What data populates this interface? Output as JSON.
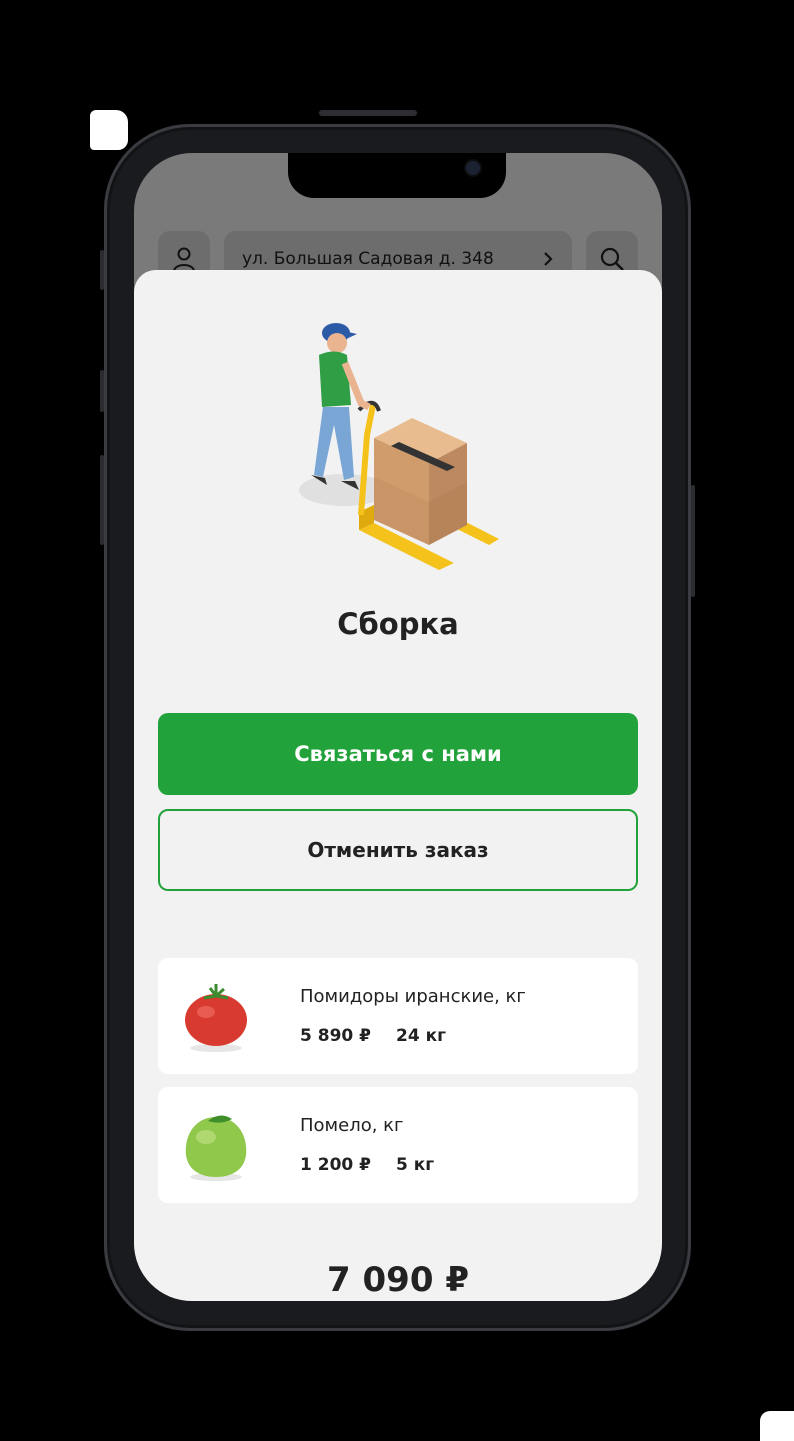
{
  "header": {
    "address": "ул. Большая Садовая д. 348",
    "icons": [
      "user-icon",
      "chevron-right-icon",
      "search-icon"
    ]
  },
  "order": {
    "status_title": "Сборка",
    "contact_label": "Связаться с нами",
    "cancel_label": "Отменить заказ",
    "items": [
      {
        "name": "Помидоры иранские, кг",
        "price": "5 890 ₽",
        "qty": "24 кг",
        "image": "tomato"
      },
      {
        "name": "Помело, кг",
        "price": "1 200 ₽",
        "qty": "5 кг",
        "image": "pomelo"
      }
    ],
    "total": "7 090 ₽"
  },
  "colors": {
    "accent": "#22a23a",
    "sheet_bg": "#f2f2f2",
    "card_bg": "#ffffff"
  }
}
